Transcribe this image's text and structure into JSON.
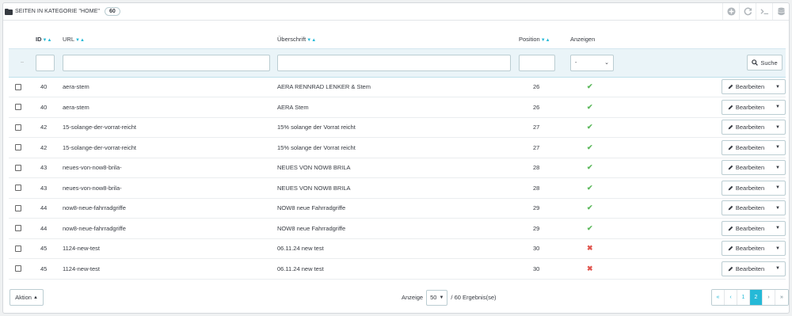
{
  "header": {
    "title": "Seiten in Kategorie \"Home\"",
    "count": "60",
    "tools": [
      "add-icon",
      "refresh-icon",
      "sql-terminal-icon",
      "database-icon"
    ]
  },
  "columns": {
    "id": "ID",
    "url": "URL",
    "heading": "Überschrift",
    "position": "Position",
    "display": "Anzeigen"
  },
  "filter": {
    "select_value": "-",
    "search_label": "Suche",
    "reset_marker": "--"
  },
  "rows": [
    {
      "id": "40",
      "url": "aera-stem",
      "heading": "AERA RENNRAD LENKER & Stem",
      "position": "26",
      "display": true
    },
    {
      "id": "40",
      "url": "aera-stem",
      "heading": "AERA Stem",
      "position": "26",
      "display": true
    },
    {
      "id": "42",
      "url": "15-solange-der-vorrat-reicht",
      "heading": "15% solange der Vorrat reicht",
      "position": "27",
      "display": true
    },
    {
      "id": "42",
      "url": "15-solange-der-vorrat-reicht",
      "heading": "15% solange der Vorrat reicht",
      "position": "27",
      "display": true
    },
    {
      "id": "43",
      "url": "neues-von-now8-brila-",
      "heading": "NEUES VON NOW8 BRILA",
      "position": "28",
      "display": true
    },
    {
      "id": "43",
      "url": "neues-von-now8-brila-",
      "heading": "NEUES VON NOW8 BRILA",
      "position": "28",
      "display": true
    },
    {
      "id": "44",
      "url": "now8-neue-fahrradgriffe",
      "heading": "NOW8 neue Fahrradgriffe",
      "position": "29",
      "display": true
    },
    {
      "id": "44",
      "url": "now8-neue-fahrradgriffe",
      "heading": "NOW8 neue Fahrradgriffe",
      "position": "29",
      "display": true
    },
    {
      "id": "45",
      "url": "1124-new-test",
      "heading": "06.11.24 new test",
      "position": "30",
      "display": false
    },
    {
      "id": "45",
      "url": "1124-new-test",
      "heading": "06.11.24 new test",
      "position": "30",
      "display": false
    }
  ],
  "row_action_label": "Bearbeiten",
  "footer": {
    "bulk_label": "Aktion",
    "show_label": "Anzeige",
    "per_page": "50",
    "results_text": "/ 60 Ergebnis(se)",
    "pages": [
      "«",
      "‹",
      "1",
      "2",
      "›",
      "»"
    ],
    "active_page": "2"
  },
  "colors": {
    "accent": "#25b9d7",
    "enabled": "#5cb85c",
    "disabled": "#e0564f"
  }
}
